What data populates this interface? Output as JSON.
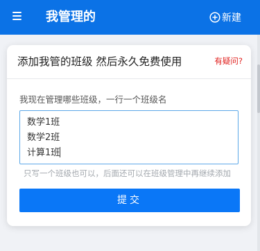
{
  "header": {
    "title": "我管理的",
    "new_label": "新建"
  },
  "card": {
    "title": "添加我管的班级 然后永久免费使用",
    "help_link": "有疑问?",
    "field_label": "我现在管理哪些班级，一行一个班级名",
    "class_names": [
      "数学1班",
      "数学2班",
      "计算1班"
    ],
    "hint": "只写一个班级也可以，后面还可以在班级管理中再继续添加",
    "submit_label": "提交"
  },
  "colors": {
    "header_bg": "#0b72e6",
    "primary_button": "#0a77f7",
    "help_link": "#e0201e",
    "textarea_border": "#5aa7e8"
  }
}
